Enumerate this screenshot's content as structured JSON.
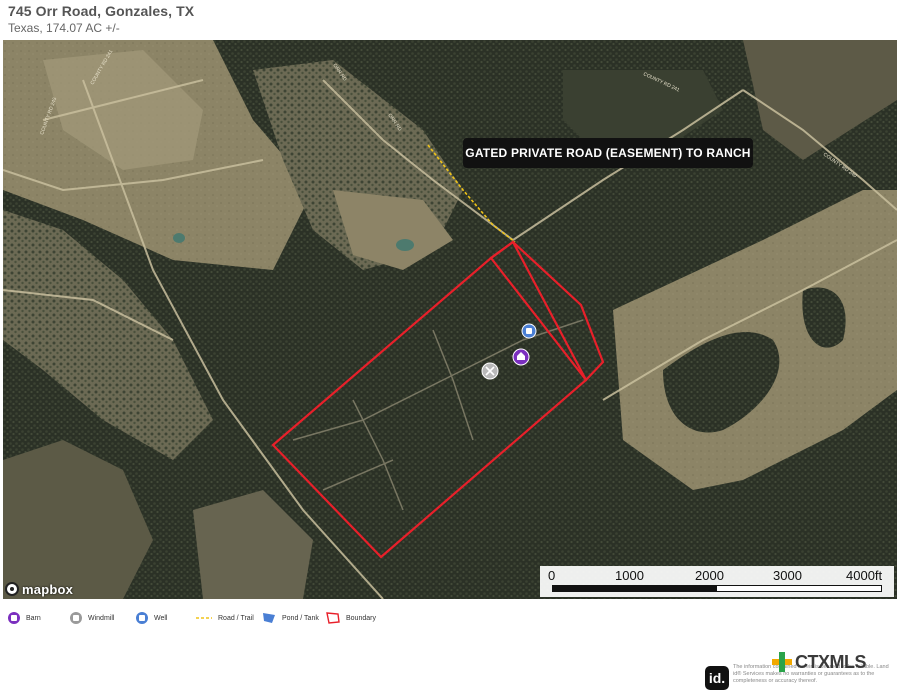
{
  "header": {
    "title": "745 Orr Road, Gonzales, TX",
    "subtitle": "Texas, 174.07 AC +/-"
  },
  "map": {
    "callout": "GATED PRIVATE ROAD (EASEMENT) TO RANCH",
    "road_labels": [
      "COUNTY RD 245",
      "COUNTY RD 241",
      "ORR RD",
      "ORR RD",
      "COUNTY RD 241",
      "COUNTY RD 240"
    ],
    "boundary_color": "#e8202a",
    "trail_color": "#f0c419",
    "markers": [
      {
        "type": "well",
        "color": "#4a7fd4",
        "icon": "well-icon"
      },
      {
        "type": "barn",
        "color": "#7b2fbf",
        "icon": "barn-icon"
      },
      {
        "type": "windmill",
        "color": "#b9b9b9",
        "icon": "windmill-icon"
      }
    ],
    "attribution": "mapbox"
  },
  "scale": {
    "labels": [
      "0",
      "1000",
      "2000",
      "3000",
      "4000ft"
    ]
  },
  "legend": [
    {
      "label": "Barn",
      "icon": "barn-icon",
      "color": "#7b2fbf"
    },
    {
      "label": "Windmill",
      "icon": "windmill-icon",
      "color": "#9a9a9a"
    },
    {
      "label": "Well",
      "icon": "well-icon",
      "color": "#4a7fd4"
    },
    {
      "label": "Road / Trail",
      "icon": "road-trail-icon",
      "color": "#f0c419"
    },
    {
      "label": "Pond / Tank",
      "icon": "pond-icon",
      "color": "#4a7fd4"
    },
    {
      "label": "Boundary",
      "icon": "boundary-icon",
      "color": "#e8202a"
    }
  ],
  "footer": {
    "id_badge": "id.",
    "brand": "CTXMLS",
    "disclaimer": "The information contained herein is deemed to be reliable. Land id® Services makes no warranties or guarantees as to the completeness or accuracy thereof."
  }
}
